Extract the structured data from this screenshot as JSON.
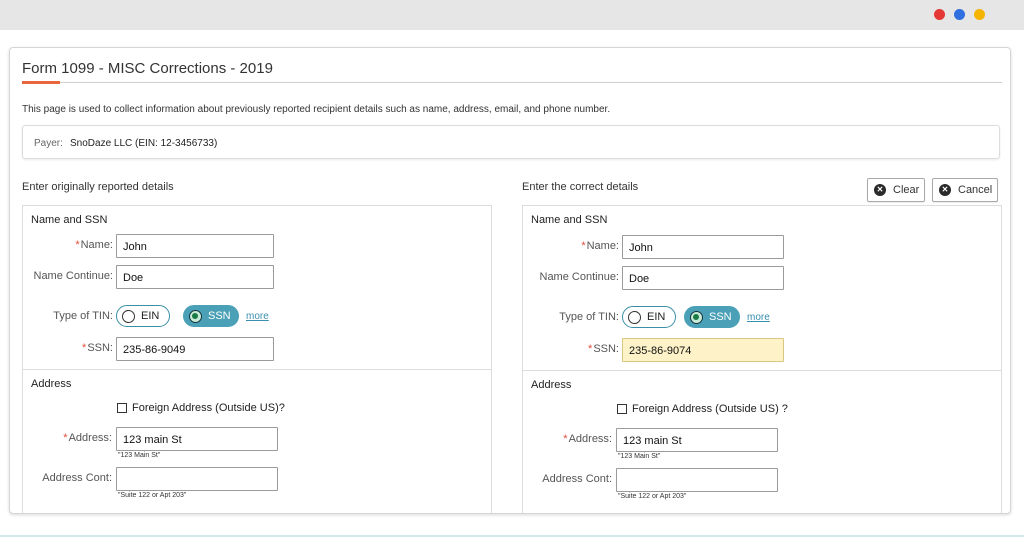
{
  "window": {
    "dots": [
      {
        "name": "red-dot",
        "color": "#e53935"
      },
      {
        "name": "blue-dot",
        "color": "#2f6fe0"
      },
      {
        "name": "yellow-dot",
        "color": "#f4b400"
      }
    ]
  },
  "page": {
    "title": "Form 1099 - MISC Corrections - 2019",
    "description": "This page is used to collect information about previously reported recipient details such as name, address, email, and phone number."
  },
  "payer": {
    "label": "Payer:",
    "value": "SnoDaze LLC (EIN: 12-3456733)"
  },
  "buttons": {
    "clear_label": "Clear",
    "cancel_label": "Cancel",
    "clear_icon": "close-circle-icon",
    "cancel_icon": "close-circle-icon"
  },
  "original": {
    "heading": "Enter originally reported details",
    "name_group": "Name and SSN",
    "name_label": "Name:",
    "name_value": "John",
    "name_cont_label": "Name Continue:",
    "name_cont_value": "Doe",
    "tin_label": "Type of TIN:",
    "tin_ein": "EIN",
    "tin_ssn": "SSN",
    "tin_selected": "SSN",
    "more": "more",
    "ssn_label": "SSN:",
    "ssn_value": "235-86-9049",
    "address_group": "Address",
    "foreign_label": "Foreign Address (Outside US)?",
    "address_label": "Address:",
    "address_value": "123 main St",
    "address_hint": "\"123 Main St\"",
    "address_cont_label": "Address Cont:",
    "address_cont_value": "",
    "address_cont_hint": "\"Suite 122 or Apt 203\""
  },
  "corrected": {
    "heading": "Enter the correct details",
    "name_group": "Name and SSN",
    "name_label": "Name:",
    "name_value": "John",
    "name_cont_label": "Name Continue:",
    "name_cont_value": "Doe",
    "tin_label": "Type of TIN:",
    "tin_ein": "EIN",
    "tin_ssn": "SSN",
    "tin_selected": "SSN",
    "more": "more",
    "ssn_label": "SSN:",
    "ssn_value": "235-86-9074",
    "address_group": "Address",
    "foreign_label": "Foreign Address (Outside US) ?",
    "address_label": "Address:",
    "address_value": "123 main St",
    "address_hint": "\"123 Main St\"",
    "address_cont_label": "Address Cont:",
    "address_cont_value": "",
    "address_cont_hint": "\"Suite 122 or Apt 203\""
  },
  "colors": {
    "accent": "#e8663d",
    "pill_active": "#4aa0b6",
    "required": "#e24a3b",
    "changed_field": "#fdf2c8"
  }
}
